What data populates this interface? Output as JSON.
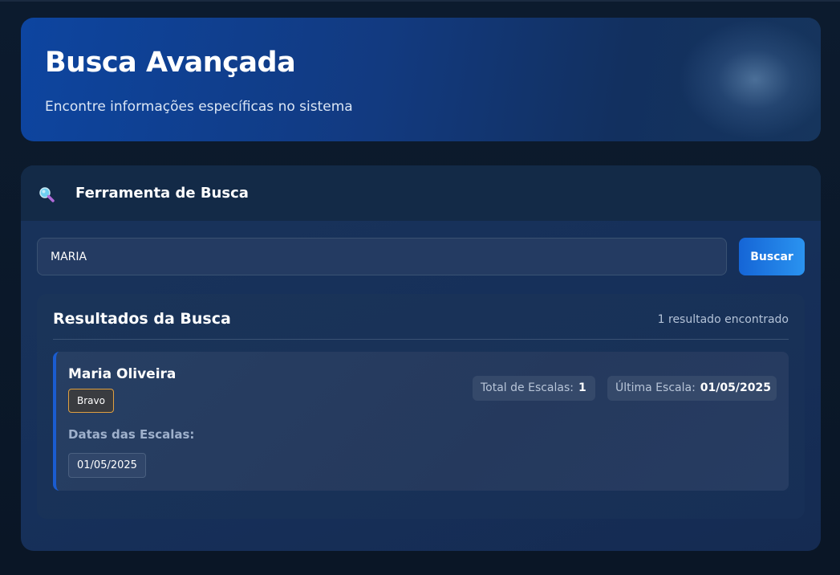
{
  "hero": {
    "title": "Busca Avançada",
    "subtitle": "Encontre informações específicas no sistema"
  },
  "search_tool": {
    "title": "Ferramenta de Busca",
    "icon": "magnifier-icon",
    "input_value": "MARIA",
    "button_label": "Buscar"
  },
  "results": {
    "title": "Resultados da Busca",
    "count_text": "1 resultado encontrado",
    "items": [
      {
        "name": "Maria Oliveira",
        "team": "Bravo",
        "total_label": "Total de Escalas:",
        "total_value": "1",
        "last_label": "Última Escala:",
        "last_value": "01/05/2025",
        "dates_label": "Datas das Escalas:",
        "dates": [
          "01/05/2025"
        ]
      }
    ]
  },
  "colors": {
    "accent": "#1565d6",
    "badge_border": "#e0a040",
    "background": "#0b1729"
  }
}
